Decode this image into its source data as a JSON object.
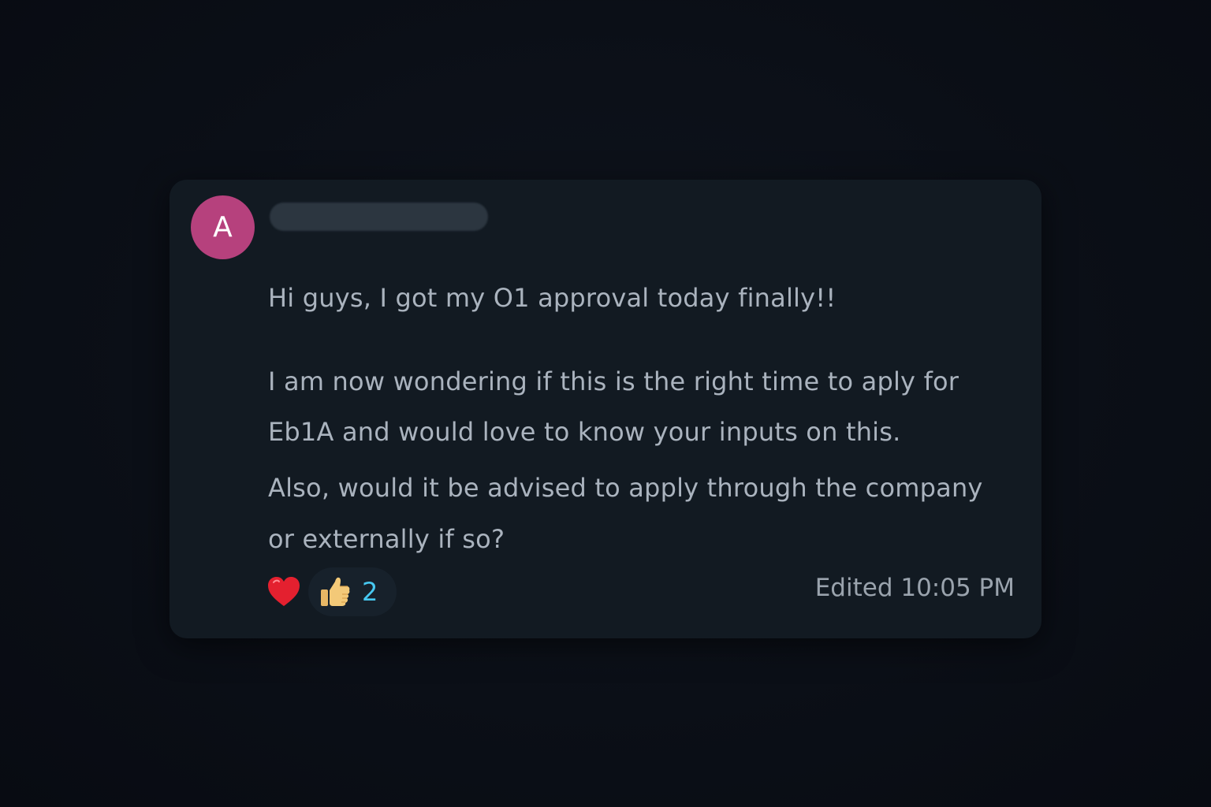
{
  "message": {
    "avatar_initial": "A",
    "lines": [
      "Hi guys, I got my O1 approval today finally!!",
      "I am now wondering if this is the right time to aply for",
      "Eb1A and would love to know your inputs on this.",
      "Also, would it be advised to apply through the company",
      "or externally if so?"
    ],
    "reactions": {
      "heart_icon": "heart-icon",
      "thumb_icon": "thumbs-up-icon",
      "count": "2"
    },
    "edited_label": "Edited 10:05 PM"
  },
  "colors": {
    "background": "#0a0e16",
    "card": "#121a22",
    "avatar": "#b6417d",
    "text": "#aab3be",
    "count_accent": "#47c8f0"
  }
}
